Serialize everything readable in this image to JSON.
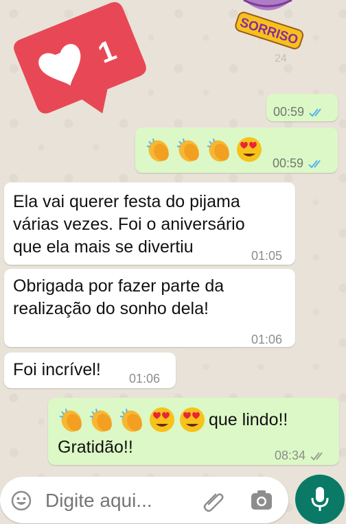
{
  "brand": {
    "logo_text": "SORRISO",
    "logo_subtext": "24"
  },
  "notification": {
    "count": "1",
    "color": "#e84855"
  },
  "messages": [
    {
      "id": "m1",
      "direction": "outgoing",
      "text": "",
      "time": "00:59",
      "status": "read"
    },
    {
      "id": "m2",
      "direction": "outgoing",
      "emojis": [
        "clapping-hands",
        "clapping-hands",
        "clapping-hands",
        "smiling-face-heart-eyes"
      ],
      "time": "00:59",
      "status": "read"
    },
    {
      "id": "m3",
      "direction": "incoming",
      "lines": [
        "Ela vai querer festa do pijama",
        "várias vezes. Foi o aniversário",
        "que ela mais se divertiu"
      ],
      "time": "01:05"
    },
    {
      "id": "m4",
      "direction": "incoming",
      "lines": [
        "Obrigada por fazer parte da",
        "realização do sonho dela!"
      ],
      "time": "01:06"
    },
    {
      "id": "m5",
      "direction": "incoming",
      "text": "Foi incrível!",
      "time": "01:06"
    },
    {
      "id": "m6",
      "direction": "outgoing",
      "emojis": [
        "clapping-hands",
        "clapping-hands",
        "clapping-hands",
        "smiling-face-heart-eyes",
        "smiling-face-heart-eyes"
      ],
      "text": "que lindo!!",
      "line2": "Gratidão!!",
      "time": "08:34",
      "status": "delivered"
    }
  ],
  "composer": {
    "placeholder": "Digite aqui..."
  },
  "colors": {
    "outgoing_bubble": "#dcf8c6",
    "incoming_bubble": "#ffffff",
    "read_tick": "#4fb6ec",
    "mic_button": "#0a7a67"
  }
}
